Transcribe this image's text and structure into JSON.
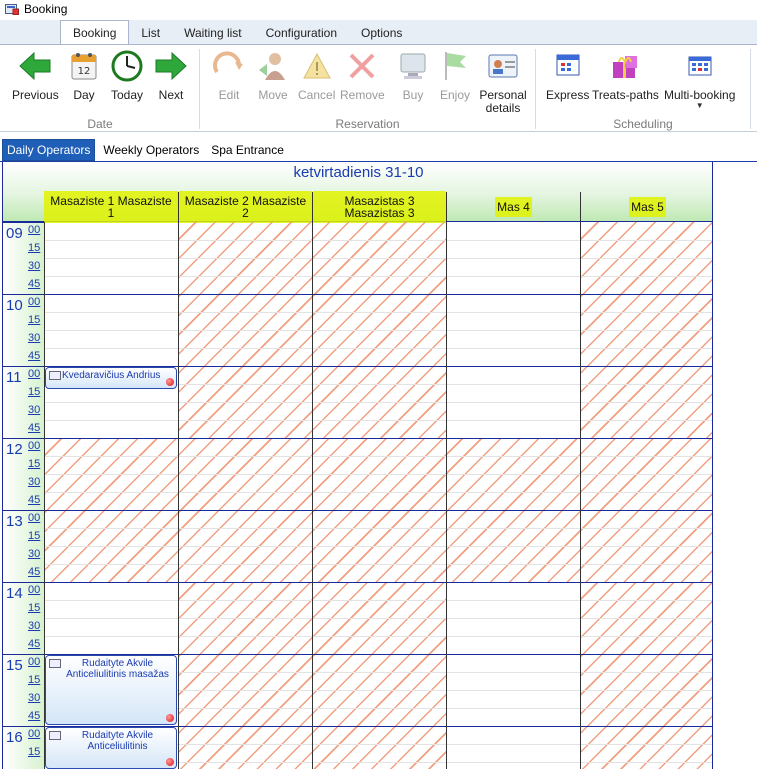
{
  "window": {
    "title": "Booking"
  },
  "ribbon_tabs": [
    "Booking",
    "List",
    "Waiting list",
    "Configuration",
    "Options"
  ],
  "groups": {
    "date": {
      "title": "Date",
      "buttons": [
        {
          "label": "Previous",
          "icon": "arrow-left-icon"
        },
        {
          "label": "Day",
          "icon": "calendar-day-icon",
          "day_number": "12"
        },
        {
          "label": "Today",
          "icon": "clock-icon"
        },
        {
          "label": "Next",
          "icon": "arrow-right-icon"
        }
      ]
    },
    "reservation": {
      "title": "Reservation",
      "buttons": [
        {
          "label": "Edit",
          "icon": "edit-icon"
        },
        {
          "label": "Move",
          "icon": "move-icon"
        },
        {
          "label": "Cancel",
          "icon": "warning-icon"
        },
        {
          "label": "Remove",
          "icon": "remove-icon"
        },
        {
          "label": "Buy",
          "icon": "monitor-icon"
        },
        {
          "label": "Enjoy",
          "icon": "flag-icon"
        },
        {
          "label": "Personal details",
          "icon": "id-card-icon"
        }
      ]
    },
    "scheduling": {
      "title": "Scheduling",
      "buttons": [
        {
          "label": "Express",
          "icon": "grid-calendar-icon"
        },
        {
          "label": "Treats-paths",
          "icon": "gift-icon"
        },
        {
          "label": "Multi-booking",
          "icon": "multi-grid-icon"
        }
      ]
    }
  },
  "sub_tabs": [
    "Daily Operators",
    "Weekly Operators",
    "Spa Entrance"
  ],
  "scheduler": {
    "date_title": "ketvirtadienis 31-10",
    "columns": [
      "Masaziste 1 Masaziste 1",
      "Masaziste 2 Masaziste 2",
      "Masazistas 3 Masazistas 3",
      "Mas 4",
      "Mas 5"
    ],
    "hours": [
      "09",
      "10",
      "11",
      "12",
      "13",
      "14",
      "15",
      "16"
    ],
    "minutes": [
      "00",
      "15",
      "30",
      "45"
    ],
    "appointments": [
      {
        "lines": [
          "Kvedaravičius Andrius"
        ]
      },
      {
        "lines": [
          "Rudaityte Akvile",
          "Anticeliulitinis masažas"
        ]
      },
      {
        "lines": [
          "Rudaityte Akvile",
          "Anticeliulitinis"
        ]
      }
    ],
    "colors": {
      "hatch": "#f0a080",
      "accent": "#1a3bb0",
      "highlight": "#e0f200"
    }
  }
}
